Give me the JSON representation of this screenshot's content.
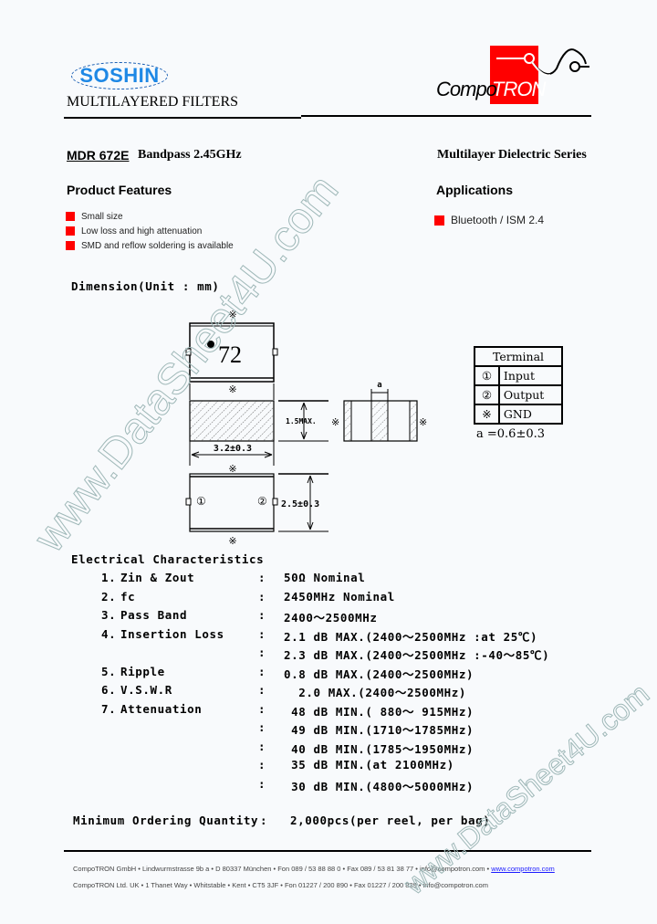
{
  "header": {
    "brand_left": "SOSHIN",
    "subtitle": "MULTILAYERED FILTERS",
    "brand_right_compo": "Compo",
    "brand_right_tron": "TRON"
  },
  "title_row": {
    "model": "MDR 672E",
    "description": "Bandpass 2.45GHz",
    "series": "Multilayer Dielectric Series"
  },
  "features": {
    "heading": "Product Features",
    "items": [
      "Small size",
      "Low loss and high attenuation",
      "SMD and reflow soldering is available"
    ]
  },
  "applications": {
    "heading": "Applications",
    "items": [
      "Bluetooth / ISM 2.4"
    ]
  },
  "dimension": {
    "title": "Dimension(Unit : mm)",
    "marking": "72",
    "gnd_mark": "※",
    "width_label": "3.2±0.3",
    "height_label": "1.5MAX.",
    "length_label": "2.5±0.3",
    "a_label": "a",
    "pin1": "①",
    "pin2": "②",
    "a_note": "a =0.6±0.3"
  },
  "terminal_table": {
    "header": "Terminal",
    "rows": [
      {
        "symbol": "①",
        "name": "Input"
      },
      {
        "symbol": "②",
        "name": "Output"
      },
      {
        "symbol": "※",
        "name": "GND"
      }
    ]
  },
  "electrical": {
    "title": "Electrical Characteristics",
    "rows": [
      {
        "num": "1.",
        "label": "Zin & Zout",
        "value": "50Ω Nominal"
      },
      {
        "num": "2.",
        "label": "fc",
        "value": "2450MHz Nominal"
      },
      {
        "num": "3.",
        "label": "Pass Band",
        "value": "2400～2500MHz"
      },
      {
        "num": "4.",
        "label": "Insertion Loss",
        "value": "2.1 dB MAX.(2400～2500MHz :at 25℃)"
      },
      {
        "num": "",
        "label": "",
        "value": "2.3 dB MAX.(2400～2500MHz :-40～85℃)"
      },
      {
        "num": "5.",
        "label": "Ripple",
        "value": "0.8 dB MAX.(2400～2500MHz)"
      },
      {
        "num": "6.",
        "label": "V.S.W.R",
        "value": "  2.0 MAX.(2400～2500MHz)"
      },
      {
        "num": "7.",
        "label": "Attenuation",
        "value": " 48 dB MIN.( 880～ 915MHz)"
      },
      {
        "num": "",
        "label": "",
        "value": " 49 dB MIN.(1710～1785MHz)"
      },
      {
        "num": "",
        "label": "",
        "value": " 40 dB MIN.(1785～1950MHz)"
      },
      {
        "num": "",
        "label": "",
        "value": " 35 dB MIN.(at 2100MHz)"
      },
      {
        "num": "",
        "label": "",
        "value": " 30 dB MIN.(4800～5000MHz)"
      }
    ],
    "colon": ":"
  },
  "moq": {
    "label": "Minimum Ordering Quantity",
    "colon": ":",
    "value": "2,000pcs(per reel, per bag)"
  },
  "footer": {
    "line1_text": "CompoTRON GmbH  •  Lindwurmstrasse 9b a  •  D    80337 München  •  Fon 089 / 53 88 88 0  •  Fax 089 / 53 81 38 77  •  info@compotron.com  • ",
    "line1_link": "www.compotron.com",
    "line2_text": "CompoTRON Ltd. UK  •  1 Thanet Way  •  Whitstable  •  Kent  •  CT5 3JF  •  Fon 01227 / 200 890  •  Fax  01227 / 200 829  •  info@compotron.com"
  },
  "watermark": {
    "text1": "www.DataSheet4U.com",
    "text2": "www.DataSheet4U.com"
  },
  "colors": {
    "soshin_blue": "#1e88e5",
    "tron_red": "#ff0000",
    "bullet_red": "#ff0000",
    "link_blue": "#1a1aff"
  }
}
